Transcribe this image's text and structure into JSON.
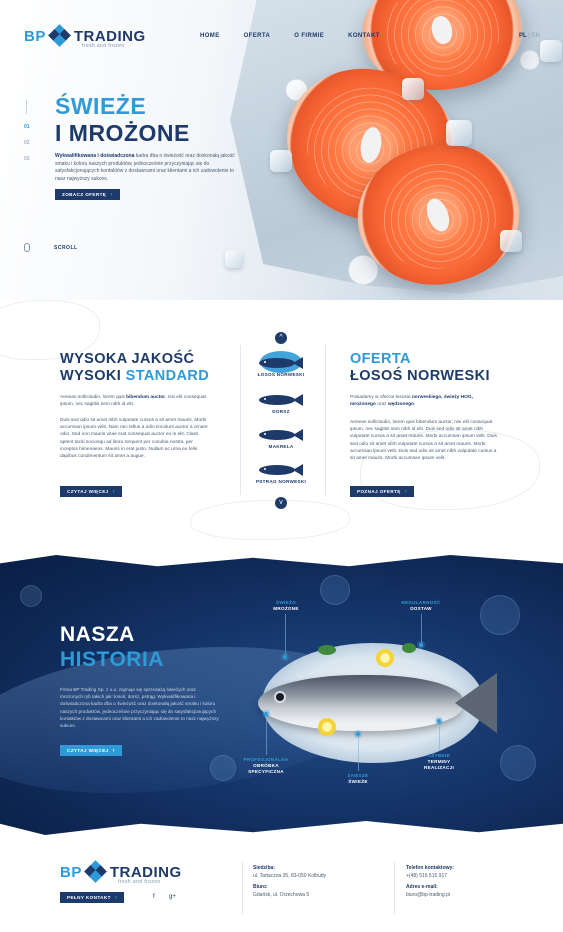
{
  "brand": {
    "part1": "BP",
    "part2": "TRADING",
    "tagline": "fresh and frozen"
  },
  "nav": {
    "items": [
      "HOME",
      "OFERTA",
      "O FIRMIE",
      "KONTAKT"
    ]
  },
  "lang": {
    "active": "PL",
    "separator": "|",
    "inactive": "EN"
  },
  "hero": {
    "title_line1": "ŚWIEŻE",
    "title_line2": "I MROŻONE",
    "text_bold": "Wykwalifikowana i doświadczona",
    "text": " kadra dba o świeżość oraz doskonałą jakość smaku i koloru naszych produktów, jednocześnie przyczyniając się do satysfakcjonujących kontaktów z dostawcami oraz klientami a ich zadowolenie to nasz najwyższy sukces.",
    "cta": "ZOBACZ OFERTĘ",
    "slides": [
      "01",
      "02",
      "03"
    ],
    "scroll": "SCROLL"
  },
  "quality": {
    "title_line1": "WYSOKA JAKOŚĆ",
    "title_line2_a": "WYSOKI ",
    "title_line2_b": "STANDARD",
    "p1_a": "Aenean sollicitudin, lorem quis ",
    "p1_bold": "bibendum auctor",
    "p1_b": ", nisi elit consequat ipsum, nec sagittis sem nibh id elit.",
    "p2": "Duis sed odio sit amet nibh vulputate cursus a sit amet mauris. Morbi accumsan ipsum velit. Nam nec tellus a odio tincidunt auctor a ornare odio. Sed non mauris vitae erat consequat auctor eu in elit. Class aptent taciti sociosqu ad litora torquent per conubia nostra, per inceptos himenaeos. Mauris in erat justo. Nullam ac urna eu felis dapibus condimentum sit amet a augue.",
    "cta": "CZYTAJ WIĘCEJ"
  },
  "fish_menu": {
    "items": [
      "ŁOSOŚ NORWESKI",
      "DORSZ",
      "MAKRELA",
      "PSTRĄG NORWESKI"
    ],
    "up": "^",
    "down": "v"
  },
  "offer": {
    "title_line1": "OFERTA",
    "title_line2": "ŁOSOŚ NORWESKI",
    "p1_a": "Posiadamy w ofercie łososia ",
    "p1_bold1": "norweskiego, świeży HOG, mrożonego",
    "p1_b": " oraz ",
    "p1_bold2": "wędzonego",
    "p1_c": ".",
    "p2": "Aenean sollicitudin, lorem quis bibendum auctor, nisi elit consequat ipsum, nec sagittis sem nibh id elit. Duis sed odio sit amet nibh vulputate cursus a sit amet mauris. Morbi accumsan ipsum velit. Duis sed odio sit amet nibh vulputate cursus a sit amet mauris. Morbi accumsan ipsum velit. Duis sed odio sit amet nibh vulputate cursus a sit amet mauris. Morbi accumsan ipsum velit.",
    "cta": "POZNAJ OFERTĘ"
  },
  "history": {
    "title_line1": "NASZA",
    "title_line2": "HISTORIA",
    "text": "Firma BP Trading Sp. z o.o. zajmuje się sprzedażą świeżych oraz mrożonych ryb takich jak: łosoś, dorsz, pstrąg. Wykwalifikowana i doświadczona kadra dba o świeżość oraz doskonałą jakość smaku i koloru naszych produktów, jednocześnie przyczyniając się do satysfakcjonujących kontaktów z dostawcami oraz klientami a ich zadowolenie to nasz najwyższy sukces.",
    "cta": "CZYTAJ WIĘCEJ",
    "callouts": {
      "fresh_frozen": {
        "l1": "ŚWIEŻO",
        "l2": "MROŻONE"
      },
      "delivery": {
        "l1": "REGULARNOŚĆ",
        "l2": "DOSTAW"
      },
      "processing": {
        "l1": "PROFESJONALNA",
        "l2": "OBRÓBKA",
        "l3": "SPECYFICZNA"
      },
      "always_fresh": {
        "l1": "ZAWSZE",
        "l2": "ŚWIEŻE"
      },
      "fast": {
        "l1": "SZYBKIE",
        "l2": "TERMINY",
        "l3": "REALIZACJI"
      }
    }
  },
  "footer": {
    "cta": "PEŁNY KONTAKT",
    "social": [
      "f",
      "g+"
    ],
    "hq_label": "Siedziba:",
    "hq_value": "ul. Tartaczna 35, 83-050 Kolbudy",
    "office_label": "Biuro:",
    "office_value": "Gdańsk, ul. Orzechowa 5",
    "phone_label": "Telefon kontaktowy:",
    "phone_value": "+(48) 516 515 917",
    "email_label": "Adres e-mail:",
    "email_value": "biuro@bp-trading.pl"
  }
}
